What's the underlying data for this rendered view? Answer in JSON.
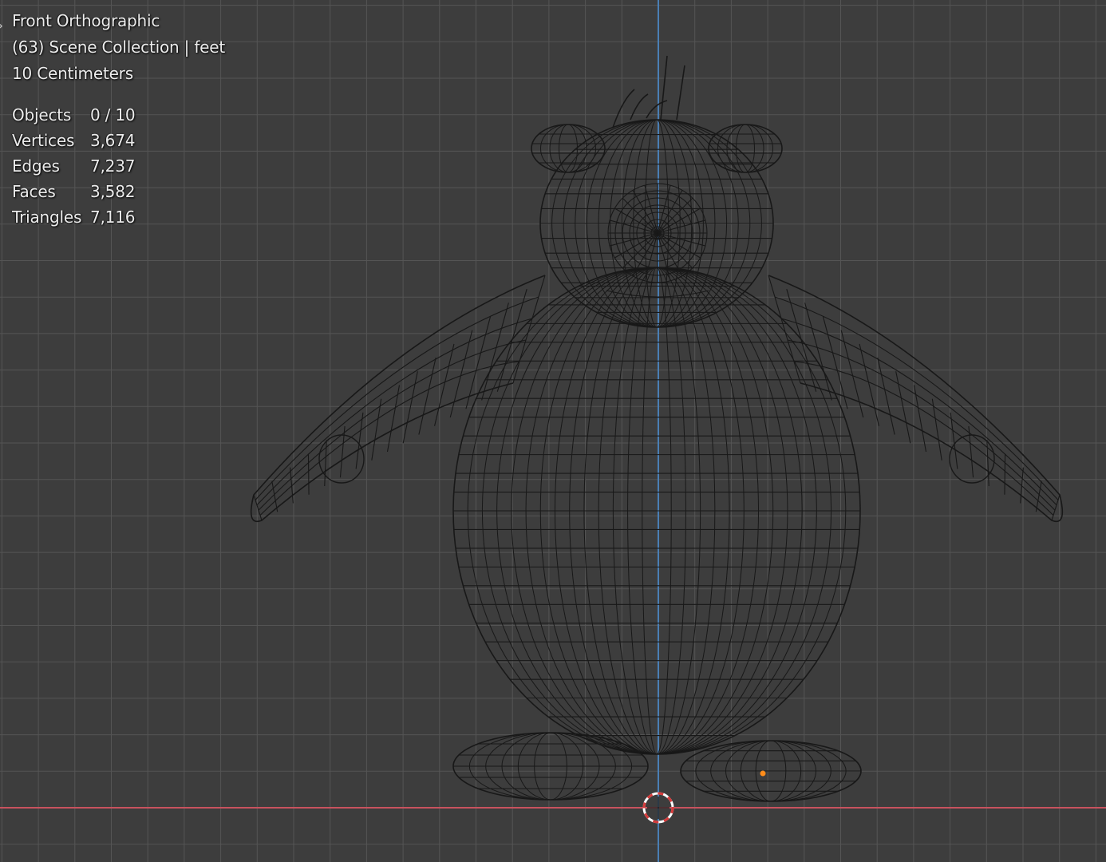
{
  "viewport": {
    "view_name": "Front Orthographic",
    "collection_line": "(63) Scene Collection | feet",
    "scale_line": "10 Centimeters",
    "stats": [
      {
        "key": "Objects",
        "value": "0 / 10"
      },
      {
        "key": "Vertices",
        "value": "3,674"
      },
      {
        "key": "Edges",
        "value": "7,237"
      },
      {
        "key": "Faces",
        "value": "3,582"
      },
      {
        "key": "Triangles",
        "value": "7,116"
      }
    ]
  },
  "colors": {
    "background": "#3d3d3d",
    "grid": "#555555",
    "x_axis": "#c8525e",
    "z_axis": "#4a7fb5",
    "wire": "#181818",
    "origin": "#ff8c1a"
  },
  "icons": {
    "sidebar_toggle": "chevron-right-icon",
    "cursor": "3d-cursor-icon",
    "origin": "object-origin-icon"
  }
}
